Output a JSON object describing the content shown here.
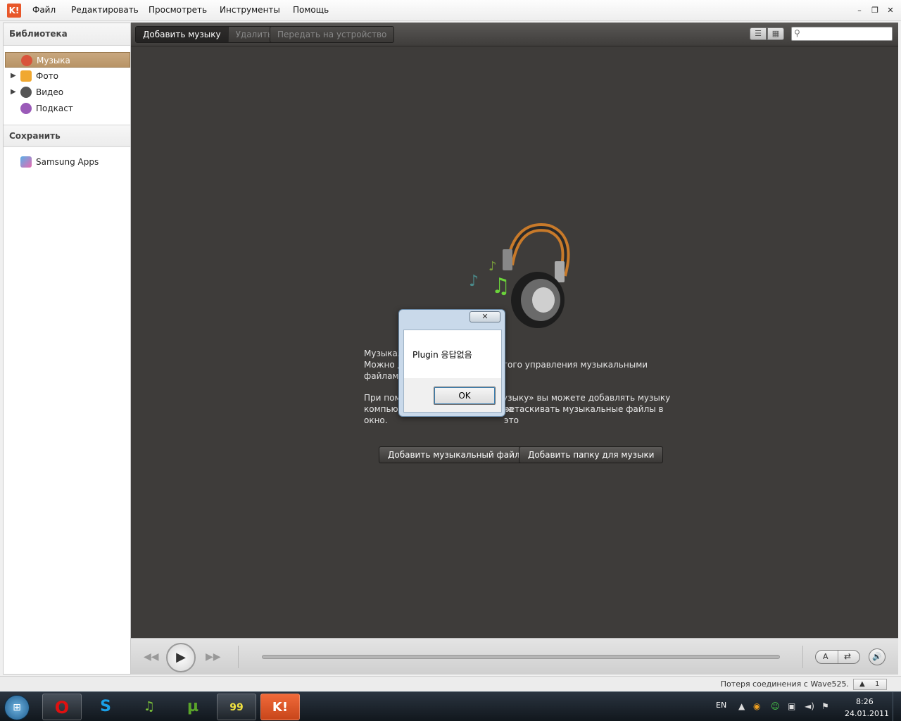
{
  "menubar": {
    "logo": "K!",
    "items": [
      "Файл",
      "Редактировать",
      "Просмотреть",
      "Инструменты",
      "Помощь"
    ],
    "minimize": "–",
    "restore": "❐",
    "close": "✕"
  },
  "sidebar": {
    "library_header": "Библиотека",
    "library_items": [
      {
        "label": "Музыка",
        "icon": "music-note-icon",
        "selected": true
      },
      {
        "label": "Фото",
        "icon": "photo-folder-icon",
        "expandable": true
      },
      {
        "label": "Видео",
        "icon": "film-reel-icon",
        "expandable": true
      },
      {
        "label": "Подкаст",
        "icon": "podcast-icon"
      }
    ],
    "save_header": "Сохранить",
    "save_items": [
      {
        "label": "Samsung Apps",
        "icon": "samsung-apps-icon"
      }
    ]
  },
  "toolbar": {
    "add_music": "Добавить музыку",
    "delete": "Удалить",
    "send_to_device": "Передать на устройство",
    "list_view_icon": "list-view-icon",
    "grid_view_icon": "grid-view-icon",
    "search_placeholder": ""
  },
  "content": {
    "line1a": "Музыкал",
    "line2a": "Можно д",
    "line2b": "того управления музыкальными",
    "line3a": "файлами",
    "line4a": "При пом",
    "line4b": "узыку» вы можете добавлять музыку на",
    "line5a": "компьют",
    "line5b": "ретаскивать музыкальные файлы в это",
    "line6a": "окно.",
    "add_file_button": "Добавить музыкальный файл",
    "add_folder_button": "Добавить папку для музыки"
  },
  "player": {
    "prev": "◀◀",
    "play": "▶",
    "next": "▶▶",
    "repeat": "A",
    "shuffle": "⇄",
    "volume": "🔊",
    "progress": 0
  },
  "statusbar": {
    "text": "Потеря соединения с Wave525.",
    "counter_arrow": "▲",
    "counter_value": "1"
  },
  "dialog": {
    "close": "✕",
    "message": "Plugin 응답없음",
    "ok": "OK"
  },
  "taskbar": {
    "lang": "EN",
    "time": "8:26",
    "date": "24.01.2011",
    "apps": [
      {
        "name": "opera",
        "glyph": "O",
        "color": "#e01010"
      },
      {
        "name": "skype",
        "glyph": "S",
        "color": "#1aa0e8"
      },
      {
        "name": "aimp",
        "glyph": "♫",
        "color": "#7cc43a"
      },
      {
        "name": "utorrent",
        "glyph": "µ",
        "color": "#5aa52a"
      },
      {
        "name": "99-app",
        "glyph": "99",
        "color": "#f0e040"
      },
      {
        "name": "kies",
        "glyph": "K!",
        "color": "#ffffff"
      }
    ]
  },
  "colors": {
    "accent": "#e8572a",
    "selected_item": "#c8a77f",
    "content_bg": "#3e3c3a"
  }
}
